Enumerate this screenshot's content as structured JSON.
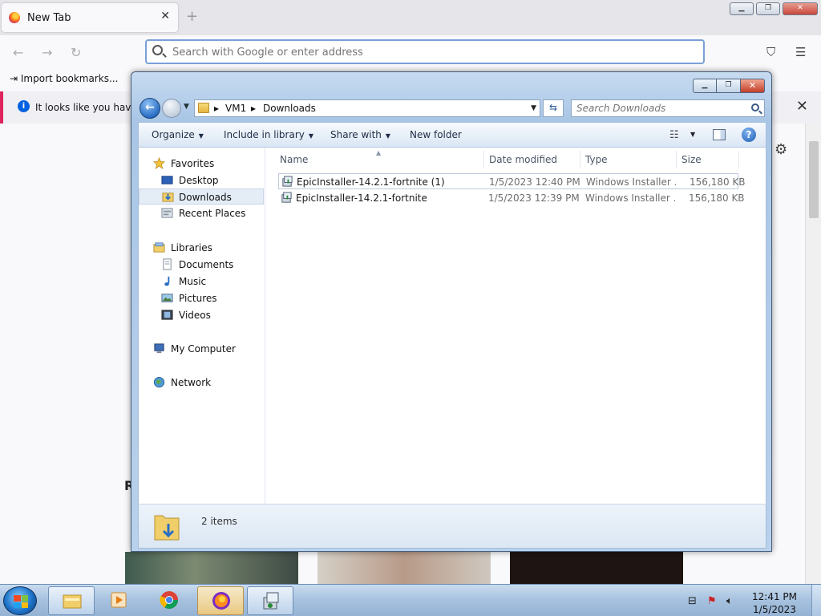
{
  "firefox": {
    "tab_title": "New Tab",
    "new_tab_glyph": "+",
    "close_tab_glyph": "✕",
    "url_placeholder": "Search with Google or enter address",
    "bookmark_label": "Import bookmarks...",
    "info_text": "It looks like you haven't",
    "section_letter": "R",
    "window_buttons": {
      "minimize": "▁",
      "restore": "❐",
      "close": "✕"
    }
  },
  "explorer": {
    "breadcrumb": [
      "VM1",
      "Downloads"
    ],
    "search_placeholder": "Search Downloads",
    "toolbar": {
      "organize": "Organize",
      "include_in_library": "Include in library",
      "share_with": "Share with",
      "new_folder": "New folder",
      "help": "?"
    },
    "nav": {
      "favorites": "Favorites",
      "desktop": "Desktop",
      "downloads": "Downloads",
      "recent_places": "Recent Places",
      "libraries": "Libraries",
      "documents": "Documents",
      "music": "Music",
      "pictures": "Pictures",
      "videos": "Videos",
      "my_computer": "My Computer",
      "network": "Network"
    },
    "columns": {
      "name": "Name",
      "date_modified": "Date modified",
      "type": "Type",
      "size": "Size"
    },
    "files": [
      {
        "name": "EpicInstaller-14.2.1-fortnite (1)",
        "date": "1/5/2023 12:40 PM",
        "type": "Windows Installer ...",
        "size": "156,180 KB"
      },
      {
        "name": "EpicInstaller-14.2.1-fortnite",
        "date": "1/5/2023 12:39 PM",
        "type": "Windows Installer ...",
        "size": "156,180 KB"
      }
    ],
    "status": "2 items"
  },
  "taskbar": {
    "time": "12:41 PM",
    "date": "1/5/2023"
  },
  "colors": {
    "accent_blue": "#2a6ec5",
    "selection_bg": "#e4ecf6",
    "folder_yellow": "#e4b43f"
  }
}
